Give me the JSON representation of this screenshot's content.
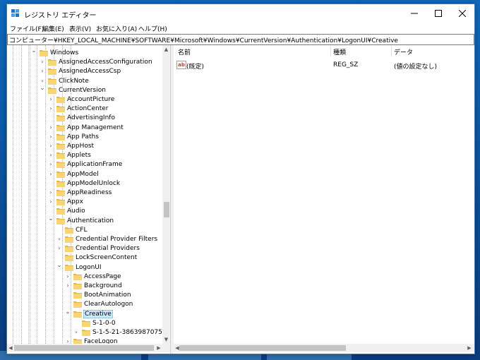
{
  "window": {
    "title": "レジストリ エディター",
    "controls": {
      "minimize": "—",
      "maximize": "☐",
      "close": "✕"
    }
  },
  "menu": [
    "ファイル(F)",
    "編集(E)",
    "表示(V)",
    "お気に入り(A)",
    "ヘルプ(H)"
  ],
  "address": "コンピューター¥HKEY_LOCAL_MACHINE¥SOFTWARE¥Microsoft¥Windows¥CurrentVersion¥Authentication¥LogonUI¥Creative",
  "tree": [
    {
      "label": "Windows",
      "depth": 0,
      "expander": "open"
    },
    {
      "label": "AssignedAccessConfiguration",
      "depth": 1,
      "expander": "closed"
    },
    {
      "label": "AssignedAccessCsp",
      "depth": 1,
      "expander": "closed"
    },
    {
      "label": "ClickNote",
      "depth": 1,
      "expander": "closed"
    },
    {
      "label": "CurrentVersion",
      "depth": 1,
      "expander": "open"
    },
    {
      "label": "AccountPicture",
      "depth": 2,
      "expander": "closed"
    },
    {
      "label": "ActionCenter",
      "depth": 2,
      "expander": "closed"
    },
    {
      "label": "AdvertisingInfo",
      "depth": 2,
      "expander": "none"
    },
    {
      "label": "App Management",
      "depth": 2,
      "expander": "closed"
    },
    {
      "label": "App Paths",
      "depth": 2,
      "expander": "closed"
    },
    {
      "label": "AppHost",
      "depth": 2,
      "expander": "closed"
    },
    {
      "label": "Applets",
      "depth": 2,
      "expander": "closed"
    },
    {
      "label": "ApplicationFrame",
      "depth": 2,
      "expander": "closed"
    },
    {
      "label": "AppModel",
      "depth": 2,
      "expander": "closed"
    },
    {
      "label": "AppModelUnlock",
      "depth": 2,
      "expander": "none"
    },
    {
      "label": "AppReadiness",
      "depth": 2,
      "expander": "closed"
    },
    {
      "label": "Appx",
      "depth": 2,
      "expander": "closed"
    },
    {
      "label": "Audio",
      "depth": 2,
      "expander": "none"
    },
    {
      "label": "Authentication",
      "depth": 2,
      "expander": "open"
    },
    {
      "label": "CFL",
      "depth": 3,
      "expander": "none"
    },
    {
      "label": "Credential Provider Filters",
      "depth": 3,
      "expander": "closed"
    },
    {
      "label": "Credential Providers",
      "depth": 3,
      "expander": "closed"
    },
    {
      "label": "LockScreenContent",
      "depth": 3,
      "expander": "none"
    },
    {
      "label": "LogonUI",
      "depth": 3,
      "expander": "open"
    },
    {
      "label": "AccessPage",
      "depth": 4,
      "expander": "closed"
    },
    {
      "label": "Background",
      "depth": 4,
      "expander": "closed"
    },
    {
      "label": "BootAnimation",
      "depth": 4,
      "expander": "none"
    },
    {
      "label": "ClearAutologon",
      "depth": 4,
      "expander": "none"
    },
    {
      "label": "Creative",
      "depth": 4,
      "expander": "open",
      "selected": true
    },
    {
      "label": "S-1-0-0",
      "depth": 5,
      "expander": "none"
    },
    {
      "label": "S-1-5-21-3863987075",
      "depth": 5,
      "expander": "closed"
    },
    {
      "label": "FaceLogon",
      "depth": 4,
      "expander": "closed"
    }
  ],
  "list": {
    "columns": [
      "名前",
      "種類",
      "データ"
    ],
    "rows": [
      {
        "name": "(既定)",
        "type": "REG_SZ",
        "data": "(値の設定なし)",
        "icon": "string-value-icon"
      }
    ]
  },
  "colors": {
    "selection": "#cce8ff",
    "folder": "#f7d574",
    "folder_dark": "#e6b84a",
    "desktop": "#0b5fb0"
  }
}
